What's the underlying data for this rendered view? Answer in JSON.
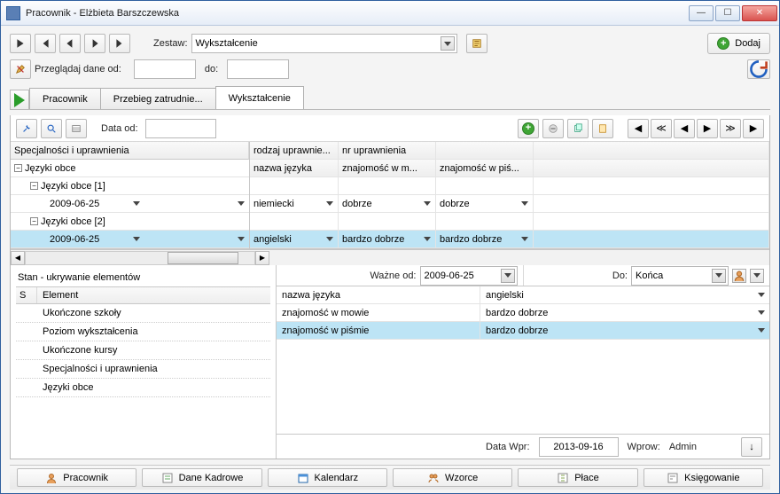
{
  "window": {
    "title": "Pracownik - Elżbieta Barszczewska"
  },
  "toolbar": {
    "zestaw_label": "Zestaw:",
    "zestaw_value": "Wykształcenie",
    "dodaj_label": "Dodaj",
    "przegladaj_label": "Przeglądaj dane od:",
    "do_label": "do:"
  },
  "tabs": {
    "t1": "Pracownik",
    "t2": "Przebieg zatrudnie...",
    "t3": "Wykształcenie"
  },
  "inner": {
    "data_od_label": "Data od:"
  },
  "tree": {
    "root": "Specjalności i uprawnienia",
    "jezyki": "Języki obce",
    "j1": "Języki obce [1]",
    "j2": "Języki obce [2]",
    "d1": "2009-06-25",
    "d2": "2009-06-25"
  },
  "gridHeaders1": {
    "c1": "rodzaj uprawnie...",
    "c2": "nr uprawnienia"
  },
  "gridHeaders2": {
    "c1": "nazwa języka",
    "c2": "znajomość w m...",
    "c3": "znajomość w piś..."
  },
  "row1": {
    "c1": "niemiecki",
    "c2": "dobrze",
    "c3": "dobrze"
  },
  "row2": {
    "c1": "angielski",
    "c2": "bardzo dobrze",
    "c3": "bardzo dobrze"
  },
  "stan": {
    "title": "Stan - ukrywanie elementów",
    "s_col": "S",
    "e_col": "Element",
    "items": {
      "i1": "Ukończone szkoły",
      "i2": "Poziom wykształcenia",
      "i3": "Ukończone kursy",
      "i4": "Specjalności i uprawnienia",
      "i5": "Języki obce"
    }
  },
  "detail": {
    "wazne_od_label": "Ważne od:",
    "wazne_od_value": "2009-06-25",
    "do_label": "Do:",
    "do_value": "Końca",
    "r1_label": "nazwa języka",
    "r1_val": "angielski",
    "r2_label": "znajomość w mowie",
    "r2_val": "bardzo dobrze",
    "r3_label": "znajomość w piśmie",
    "r3_val": "bardzo dobrze"
  },
  "footer": {
    "data_wpr_label": "Data Wpr:",
    "data_wpr_value": "2013-09-16",
    "wprow_label": "Wprow:",
    "wprow_value": "Admin"
  },
  "bottomTabs": {
    "t1": "Pracownik",
    "t2": "Dane Kadrowe",
    "t3": "Kalendarz",
    "t4": "Wzorce",
    "t5": "Płace",
    "t6": "Księgowanie"
  }
}
